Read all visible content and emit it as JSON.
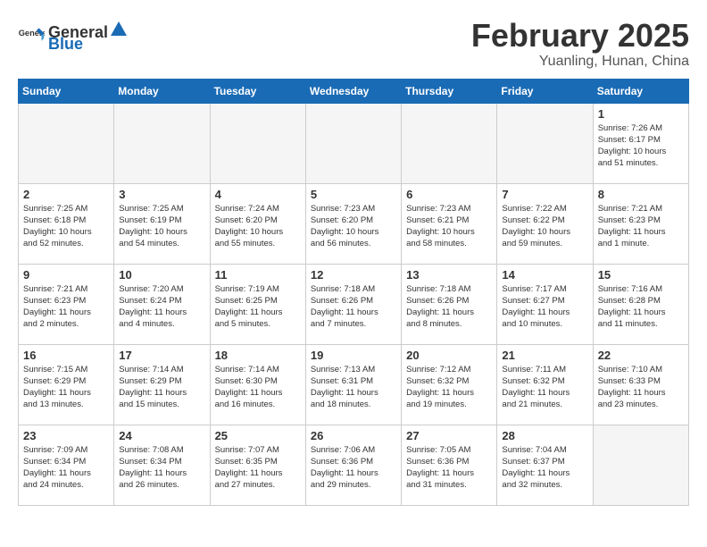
{
  "header": {
    "logo_general": "General",
    "logo_blue": "Blue",
    "month_year": "February 2025",
    "location": "Yuanling, Hunan, China"
  },
  "weekdays": [
    "Sunday",
    "Monday",
    "Tuesday",
    "Wednesday",
    "Thursday",
    "Friday",
    "Saturday"
  ],
  "weeks": [
    [
      {
        "day": "",
        "info": ""
      },
      {
        "day": "",
        "info": ""
      },
      {
        "day": "",
        "info": ""
      },
      {
        "day": "",
        "info": ""
      },
      {
        "day": "",
        "info": ""
      },
      {
        "day": "",
        "info": ""
      },
      {
        "day": "1",
        "info": "Sunrise: 7:26 AM\nSunset: 6:17 PM\nDaylight: 10 hours\nand 51 minutes."
      }
    ],
    [
      {
        "day": "2",
        "info": "Sunrise: 7:25 AM\nSunset: 6:18 PM\nDaylight: 10 hours\nand 52 minutes."
      },
      {
        "day": "3",
        "info": "Sunrise: 7:25 AM\nSunset: 6:19 PM\nDaylight: 10 hours\nand 54 minutes."
      },
      {
        "day": "4",
        "info": "Sunrise: 7:24 AM\nSunset: 6:20 PM\nDaylight: 10 hours\nand 55 minutes."
      },
      {
        "day": "5",
        "info": "Sunrise: 7:23 AM\nSunset: 6:20 PM\nDaylight: 10 hours\nand 56 minutes."
      },
      {
        "day": "6",
        "info": "Sunrise: 7:23 AM\nSunset: 6:21 PM\nDaylight: 10 hours\nand 58 minutes."
      },
      {
        "day": "7",
        "info": "Sunrise: 7:22 AM\nSunset: 6:22 PM\nDaylight: 10 hours\nand 59 minutes."
      },
      {
        "day": "8",
        "info": "Sunrise: 7:21 AM\nSunset: 6:23 PM\nDaylight: 11 hours\nand 1 minute."
      }
    ],
    [
      {
        "day": "9",
        "info": "Sunrise: 7:21 AM\nSunset: 6:23 PM\nDaylight: 11 hours\nand 2 minutes."
      },
      {
        "day": "10",
        "info": "Sunrise: 7:20 AM\nSunset: 6:24 PM\nDaylight: 11 hours\nand 4 minutes."
      },
      {
        "day": "11",
        "info": "Sunrise: 7:19 AM\nSunset: 6:25 PM\nDaylight: 11 hours\nand 5 minutes."
      },
      {
        "day": "12",
        "info": "Sunrise: 7:18 AM\nSunset: 6:26 PM\nDaylight: 11 hours\nand 7 minutes."
      },
      {
        "day": "13",
        "info": "Sunrise: 7:18 AM\nSunset: 6:26 PM\nDaylight: 11 hours\nand 8 minutes."
      },
      {
        "day": "14",
        "info": "Sunrise: 7:17 AM\nSunset: 6:27 PM\nDaylight: 11 hours\nand 10 minutes."
      },
      {
        "day": "15",
        "info": "Sunrise: 7:16 AM\nSunset: 6:28 PM\nDaylight: 11 hours\nand 11 minutes."
      }
    ],
    [
      {
        "day": "16",
        "info": "Sunrise: 7:15 AM\nSunset: 6:29 PM\nDaylight: 11 hours\nand 13 minutes."
      },
      {
        "day": "17",
        "info": "Sunrise: 7:14 AM\nSunset: 6:29 PM\nDaylight: 11 hours\nand 15 minutes."
      },
      {
        "day": "18",
        "info": "Sunrise: 7:14 AM\nSunset: 6:30 PM\nDaylight: 11 hours\nand 16 minutes."
      },
      {
        "day": "19",
        "info": "Sunrise: 7:13 AM\nSunset: 6:31 PM\nDaylight: 11 hours\nand 18 minutes."
      },
      {
        "day": "20",
        "info": "Sunrise: 7:12 AM\nSunset: 6:32 PM\nDaylight: 11 hours\nand 19 minutes."
      },
      {
        "day": "21",
        "info": "Sunrise: 7:11 AM\nSunset: 6:32 PM\nDaylight: 11 hours\nand 21 minutes."
      },
      {
        "day": "22",
        "info": "Sunrise: 7:10 AM\nSunset: 6:33 PM\nDaylight: 11 hours\nand 23 minutes."
      }
    ],
    [
      {
        "day": "23",
        "info": "Sunrise: 7:09 AM\nSunset: 6:34 PM\nDaylight: 11 hours\nand 24 minutes."
      },
      {
        "day": "24",
        "info": "Sunrise: 7:08 AM\nSunset: 6:34 PM\nDaylight: 11 hours\nand 26 minutes."
      },
      {
        "day": "25",
        "info": "Sunrise: 7:07 AM\nSunset: 6:35 PM\nDaylight: 11 hours\nand 27 minutes."
      },
      {
        "day": "26",
        "info": "Sunrise: 7:06 AM\nSunset: 6:36 PM\nDaylight: 11 hours\nand 29 minutes."
      },
      {
        "day": "27",
        "info": "Sunrise: 7:05 AM\nSunset: 6:36 PM\nDaylight: 11 hours\nand 31 minutes."
      },
      {
        "day": "28",
        "info": "Sunrise: 7:04 AM\nSunset: 6:37 PM\nDaylight: 11 hours\nand 32 minutes."
      },
      {
        "day": "",
        "info": ""
      }
    ]
  ]
}
